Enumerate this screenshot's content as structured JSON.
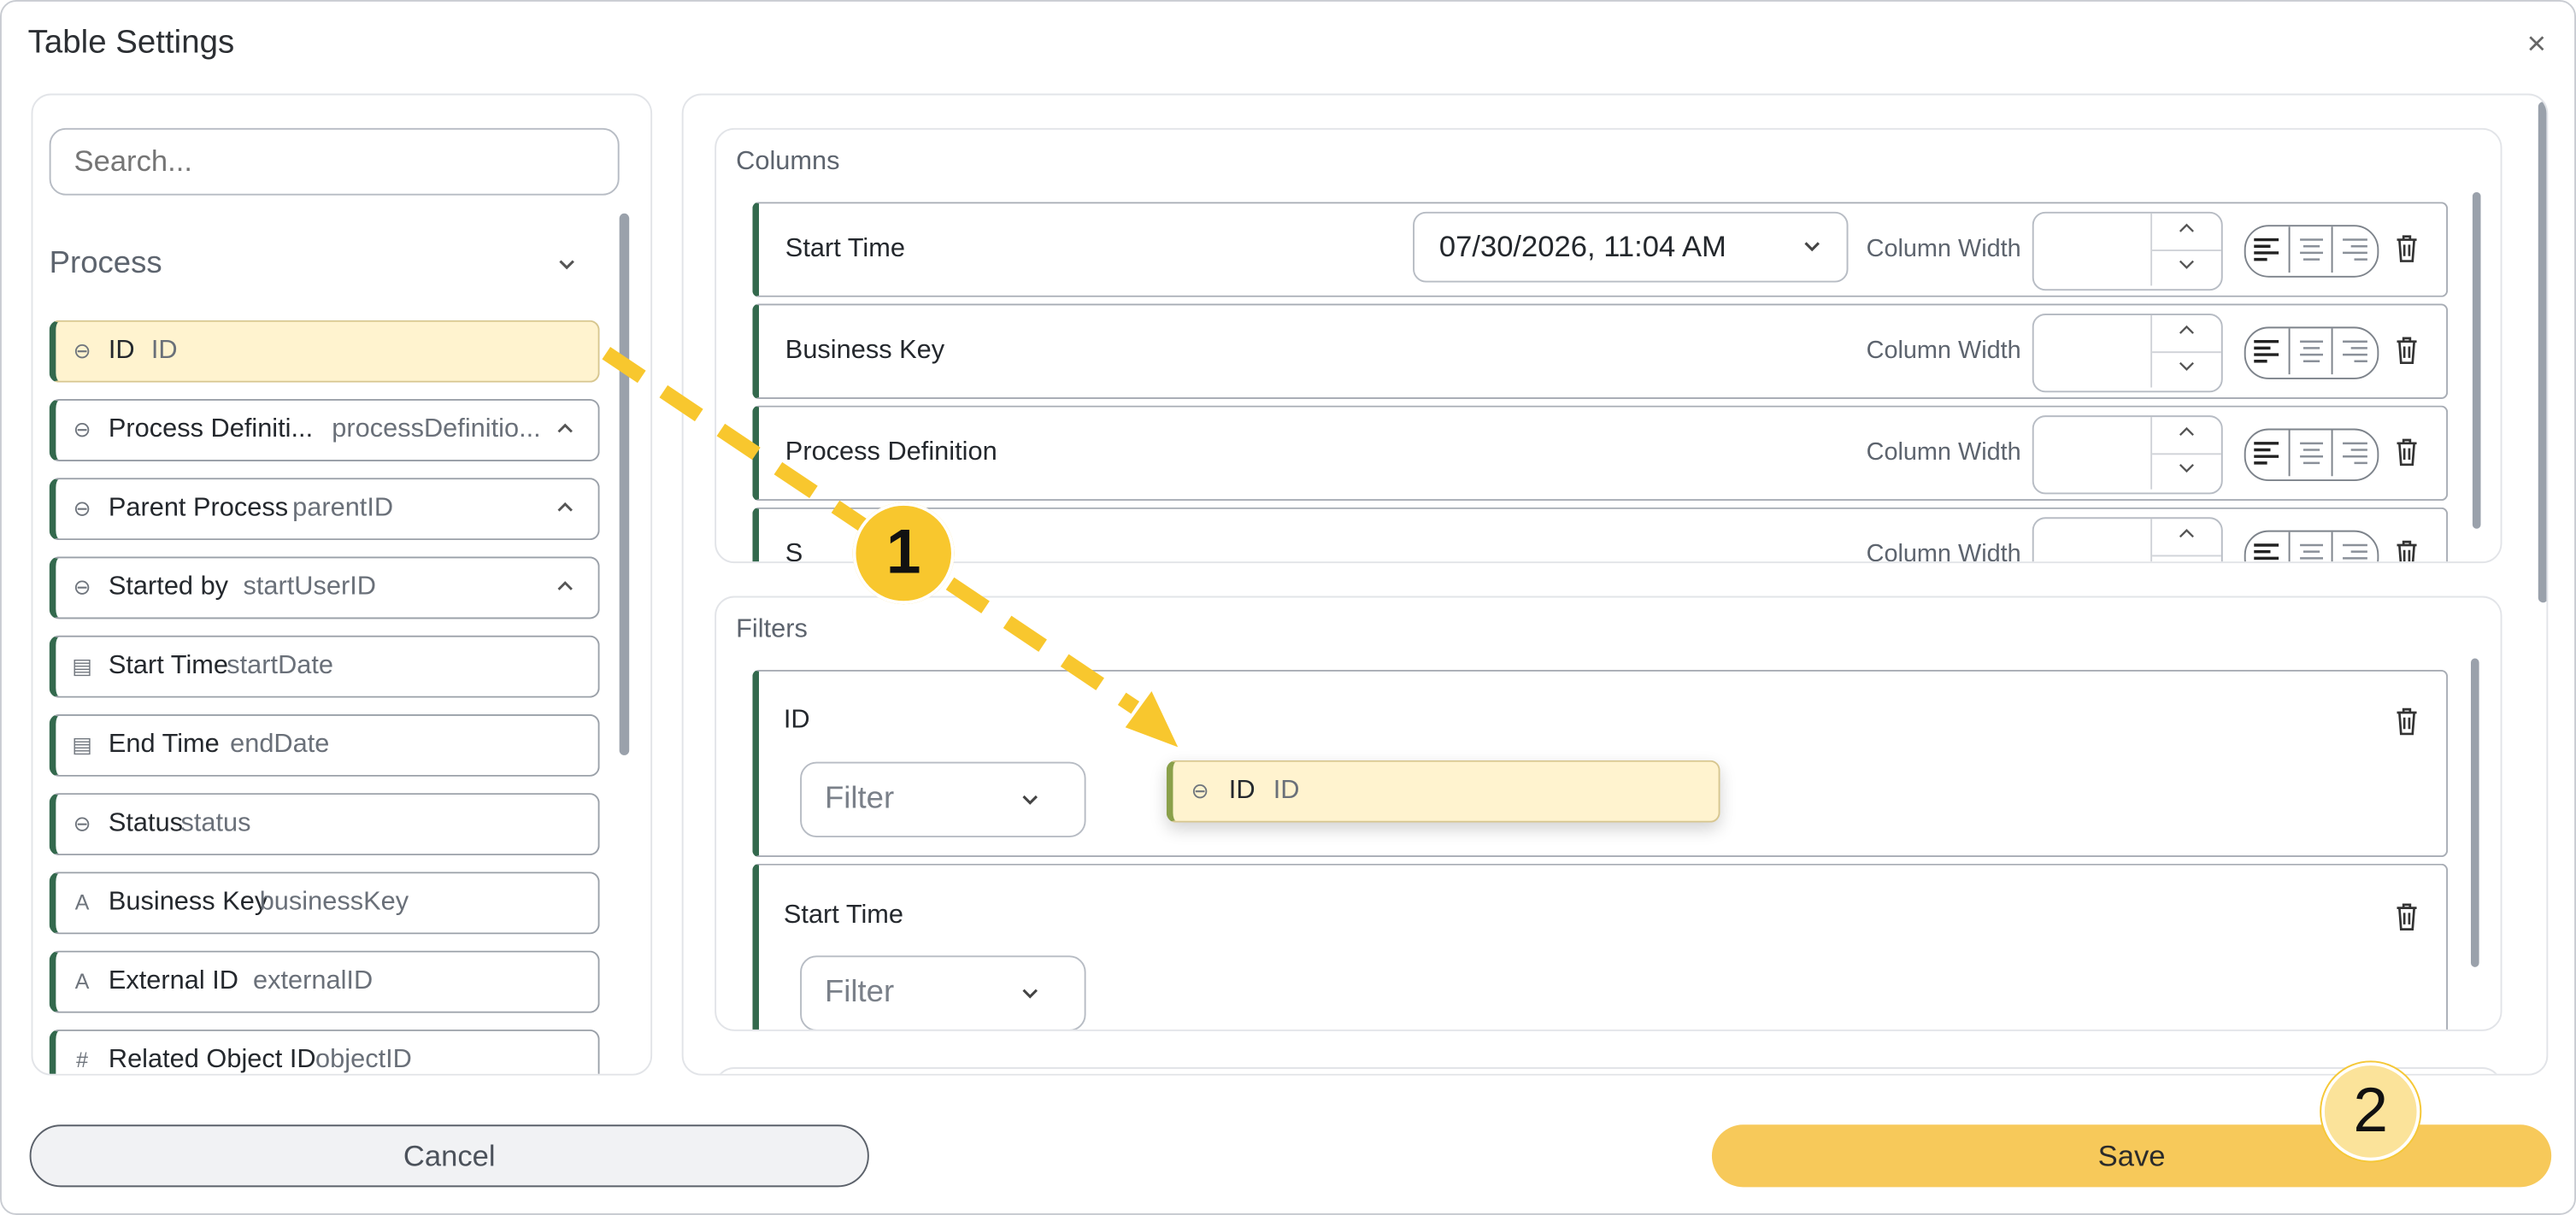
{
  "dialog": {
    "title": "Table Settings",
    "close_glyph": "×"
  },
  "search": {
    "placeholder": "Search..."
  },
  "field_list": {
    "group": "Process",
    "items": [
      {
        "name": "ID",
        "key": "ID",
        "icon": "link-icon",
        "glyph": "⊖",
        "expandable": false,
        "selected": true
      },
      {
        "name": "Process Definiti...",
        "key": "processDefinitio...",
        "icon": "link-icon",
        "glyph": "⊖",
        "expandable": true,
        "selected": false
      },
      {
        "name": "Parent Process",
        "key": "parentID",
        "icon": "link-icon",
        "glyph": "⊖",
        "expandable": true,
        "selected": false
      },
      {
        "name": "Started by",
        "key": "startUserID",
        "icon": "link-icon",
        "glyph": "⊖",
        "expandable": true,
        "selected": false
      },
      {
        "name": "Start Time",
        "key": "startDate",
        "icon": "calendar-icon",
        "glyph": "▤",
        "expandable": false,
        "selected": false
      },
      {
        "name": "End Time",
        "key": "endDate",
        "icon": "calendar-icon",
        "glyph": "▤",
        "expandable": false,
        "selected": false
      },
      {
        "name": "Status",
        "key": "status",
        "icon": "link-icon",
        "glyph": "⊖",
        "expandable": false,
        "selected": false
      },
      {
        "name": "Business Key",
        "key": "businessKey",
        "icon": "text-icon",
        "glyph": "A",
        "expandable": false,
        "selected": false
      },
      {
        "name": "External ID",
        "key": "externalID",
        "icon": "text-icon",
        "glyph": "A",
        "expandable": false,
        "selected": false
      },
      {
        "name": "Related Object ID",
        "key": "objectID",
        "icon": "hash-icon",
        "glyph": "#",
        "expandable": false,
        "selected": false
      }
    ]
  },
  "columns": {
    "title": "Columns",
    "width_label": "Column Width",
    "rows": [
      {
        "name": "Start Time",
        "date_value": "07/30/2026, 11:04 AM",
        "width": ""
      },
      {
        "name": "Business Key",
        "width": ""
      },
      {
        "name": "Process Definition",
        "width": ""
      },
      {
        "name": "S",
        "width": ""
      }
    ]
  },
  "filters": {
    "title": "Filters",
    "rows": [
      {
        "name": "ID",
        "select_placeholder": "Filter"
      },
      {
        "name": "Start Time",
        "select_placeholder": "Filter"
      }
    ]
  },
  "drag_preview": {
    "name": "ID",
    "key": "ID",
    "icon": "link-icon",
    "glyph": "⊖"
  },
  "footer": {
    "cancel": "Cancel",
    "save": "Save"
  },
  "annotations": {
    "step1": "1",
    "step2": "2"
  },
  "colors": {
    "accent_green": "#33694d",
    "highlight": "#fff3cf",
    "save": "#f7c95a",
    "arrow": "#f8c72e"
  }
}
